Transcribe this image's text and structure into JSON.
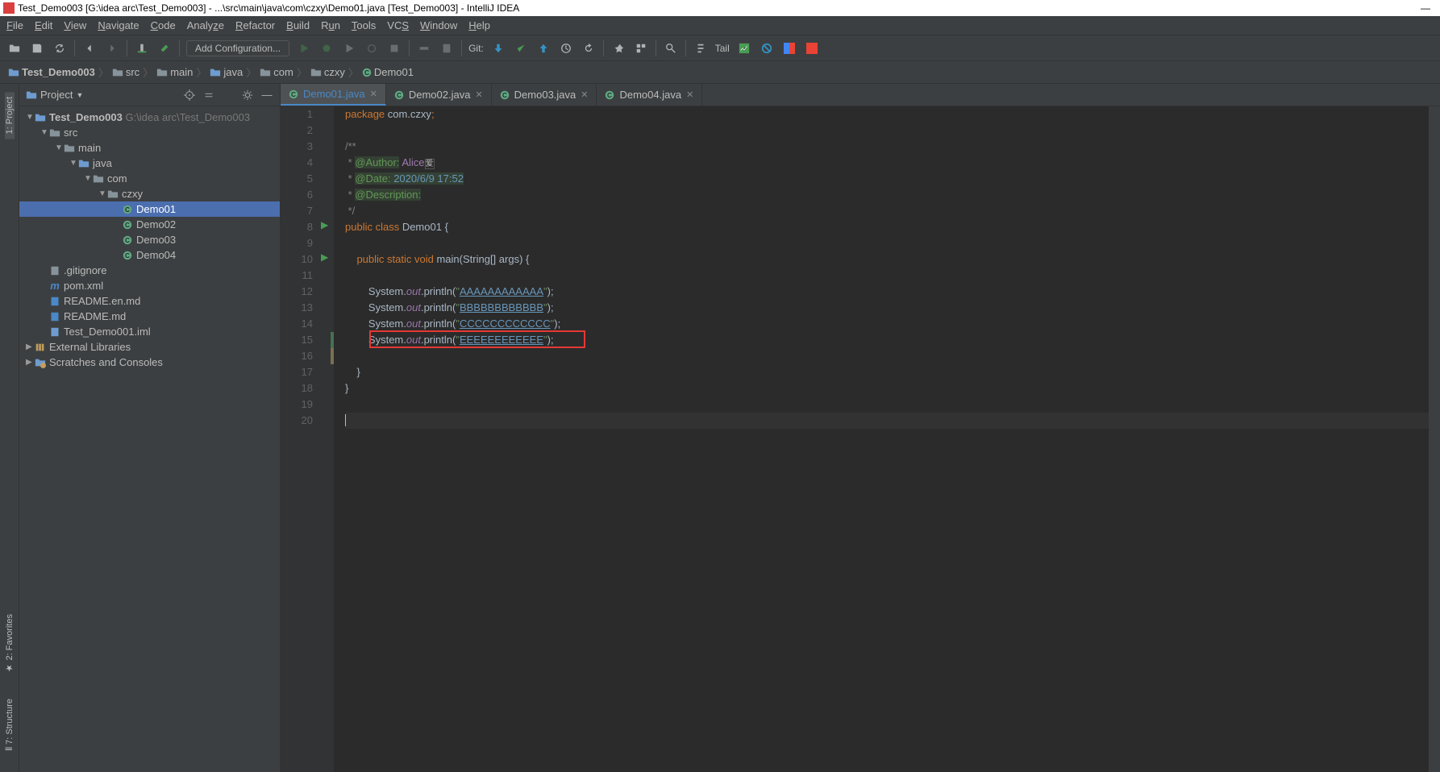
{
  "title_bar": {
    "text": "Test_Demo003 [G:\\idea arc\\Test_Demo003] - ...\\src\\main\\java\\com\\czxy\\Demo01.java [Test_Demo003] - IntelliJ IDEA",
    "minimize": "—"
  },
  "menu": {
    "items": [
      "File",
      "Edit",
      "View",
      "Navigate",
      "Code",
      "Analyze",
      "Refactor",
      "Build",
      "Run",
      "Tools",
      "VCS",
      "Window",
      "Help"
    ]
  },
  "toolbar": {
    "config_selector": "Add Configuration...",
    "git_label": "Git:",
    "tail_label": "Tail"
  },
  "breadcrumb": {
    "items": [
      "Test_Demo003",
      "src",
      "main",
      "java",
      "com",
      "czxy",
      "Demo01"
    ]
  },
  "sidebar": {
    "header_label": "Project",
    "tree": {
      "root": "Test_Demo003",
      "root_path": "G:\\idea arc\\Test_Demo003",
      "src": "src",
      "main": "main",
      "java": "java",
      "com": "com",
      "czxy": "czxy",
      "demo01": "Demo01",
      "demo02": "Demo02",
      "demo03": "Demo03",
      "demo04": "Demo04",
      "gitignore": ".gitignore",
      "pom": "pom.xml",
      "readme_en": "README.en.md",
      "readme": "README.md",
      "iml": "Test_Demo001.iml",
      "ext_lib": "External Libraries",
      "scratches": "Scratches and Consoles"
    }
  },
  "left_strip": {
    "project": "1: Project",
    "favorites": "2: Favorites",
    "structure": "7: Structure"
  },
  "tabs": [
    {
      "label": "Demo01.java",
      "active": true
    },
    {
      "label": "Demo02.java",
      "active": false
    },
    {
      "label": "Demo03.java",
      "active": false
    },
    {
      "label": "Demo04.java",
      "active": false
    }
  ],
  "code": {
    "lines": [
      "1",
      "2",
      "3",
      "4",
      "5",
      "6",
      "7",
      "8",
      "9",
      "10",
      "11",
      "12",
      "13",
      "14",
      "15",
      "16",
      "17",
      "18",
      "19",
      "20"
    ],
    "package_kw": "package ",
    "package_name": "com.czxy",
    "semi": ";",
    "doc_start": "/**",
    "doc_author_tag": "@Author:",
    "doc_author_val": " Alice",
    "doc_date_tag": "@Date:",
    "doc_date_val": " 2020/6/9 17:52",
    "doc_desc_tag": "@Description:",
    "doc_end": " */",
    "star": " * ",
    "public_kw": "public ",
    "class_kw": "class ",
    "class_name": "Demo01 ",
    "lbrace": "{",
    "rbrace": "}",
    "static_kw": "static ",
    "void_kw": "void ",
    "main_name": "main",
    "main_args": "(String[] args) ",
    "system": "System.",
    "out": "out",
    "println": ".println(",
    "quote": "\"",
    "str_a": "AAAAAAAAAAAA",
    "str_b": "BBBBBBBBBBBB",
    "str_c": "CCCCCCCCCCCC",
    "str_e": "EEEEEEEEEEEE",
    "close_call": ");"
  }
}
